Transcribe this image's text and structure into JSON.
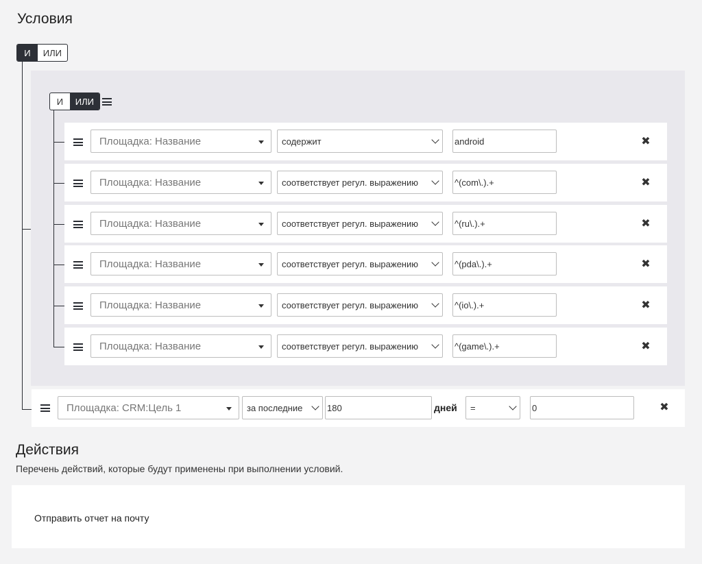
{
  "conditions": {
    "title": "Условия",
    "root_toggle": {
      "and": "И",
      "or": "ИЛИ",
      "active": "and"
    },
    "group": {
      "toggle": {
        "and": "И",
        "or": "ИЛИ",
        "active": "or"
      },
      "rows": [
        {
          "field": "Площадка: Название",
          "operator": "содержит",
          "value": "android"
        },
        {
          "field": "Площадка: Название",
          "operator": "соответствует регул. выражению",
          "value": "^(com\\.).+"
        },
        {
          "field": "Площадка: Название",
          "operator": "соответствует регул. выражению",
          "value": "^(ru\\.).+"
        },
        {
          "field": "Площадка: Название",
          "operator": "соответствует регул. выражению",
          "value": "^(pda\\.).+"
        },
        {
          "field": "Площадка: Название",
          "operator": "соответствует регул. выражению",
          "value": "^(io\\.).+"
        },
        {
          "field": "Площадка: Название",
          "operator": "соответствует регул. выражению",
          "value": "^(game\\.).+"
        }
      ]
    },
    "crm_row": {
      "field": "Площадка: CRM:Цель 1",
      "period": "за последние",
      "days_value": "180",
      "days_unit": "дней",
      "comparison": "=",
      "value": "0"
    }
  },
  "actions": {
    "title": "Действия",
    "subtitle": "Перечень действий, которые будут применены при выполнении условий.",
    "items": [
      "Отправить отчет на почту"
    ]
  },
  "icons": {
    "drag": "drag-handle-icon",
    "remove": "close-icon",
    "dropdown": "chevron-down-icon"
  }
}
